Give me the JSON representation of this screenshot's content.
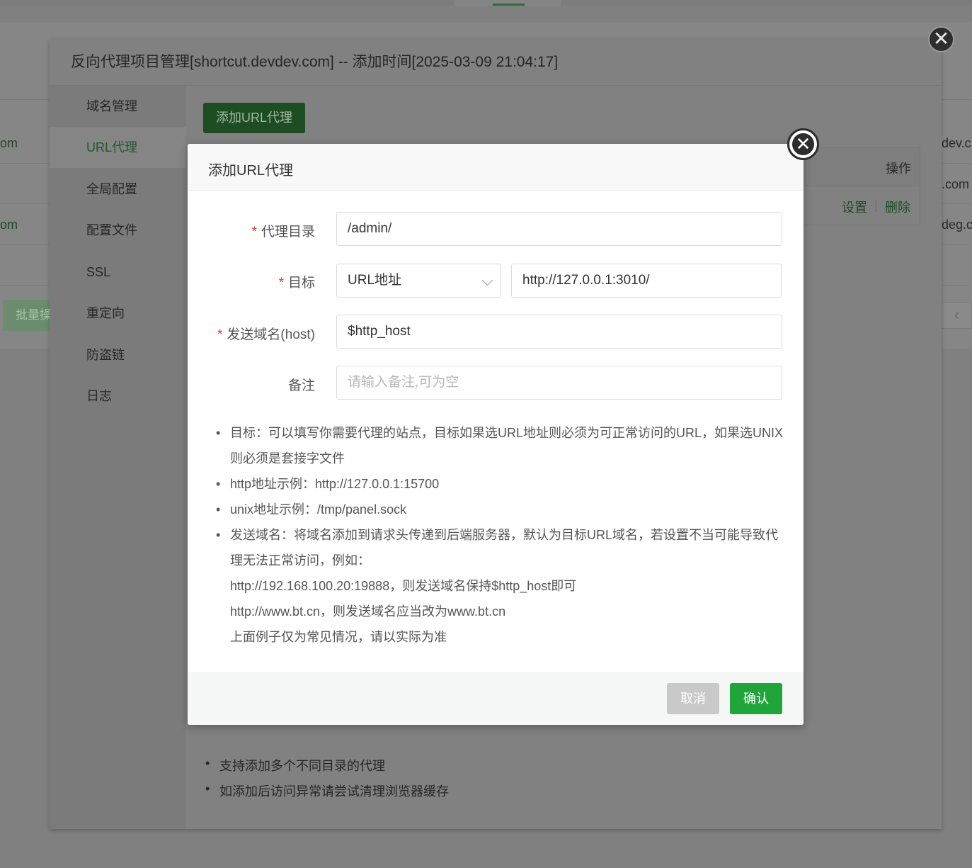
{
  "background": {
    "rows": [
      {
        "left_text": "om",
        "right_text": "dev.c"
      },
      {
        "left_text": "",
        "right_text": ".com"
      },
      {
        "left_text": "om",
        "right_text": "deg.c"
      }
    ],
    "batch_button_label": "批量操",
    "pager_prev": "‹"
  },
  "outer": {
    "title": "反向代理项目管理[shortcut.devdev.com] -- 添加时间[2025-03-09 21:04:17]",
    "close_glyph": "✕",
    "sidebar": [
      {
        "label": "域名管理"
      },
      {
        "label": "URL代理"
      },
      {
        "label": "全局配置"
      },
      {
        "label": "配置文件"
      },
      {
        "label": "SSL"
      },
      {
        "label": "重定向"
      },
      {
        "label": "防盗链"
      },
      {
        "label": "日志"
      }
    ],
    "add_button_label": "添加URL代理",
    "table_header_operation": "操作",
    "row_settings": "设置",
    "row_separator": "|",
    "row_delete": "删除",
    "tips": [
      "支持添加多个不同目录的代理",
      "如添加后访问异常请尝试清理浏览器缓存"
    ]
  },
  "dialog": {
    "title": "添加URL代理",
    "close_glyph": "✕",
    "required_mark": "*",
    "fields": {
      "proxy_dir": {
        "label": "代理目录",
        "value": "/admin/"
      },
      "target": {
        "label": "目标",
        "type_value": "URL地址",
        "url_value": "http://127.0.0.1:3010/"
      },
      "host": {
        "label": "发送域名(host)",
        "value": "$http_host"
      },
      "remark": {
        "label": "备注",
        "placeholder": "请输入备注,可为空"
      }
    },
    "help": {
      "item1_line1": "目标：可以填写你需要代理的站点，目标如果选URL地址则必须为可正常访问的URL，如果选UNIX",
      "item1_line2": "则必须是套接字文件",
      "item2": "http地址示例：http://127.0.0.1:15700",
      "item3": "unix地址示例：/tmp/panel.sock",
      "item4_line1": "发送域名：将域名添加到请求头传递到后端服务器，默认为目标URL域名，若设置不当可能导致代",
      "item4_line2": "理无法正常访问，例如：",
      "item4_line3": "http://192.168.100.20:19888，则发送域名保持$http_host即可",
      "item4_line4": "http://www.bt.cn，则发送域名应当改为www.bt.cn",
      "item4_line5": "上面例子仅为常见情况，请以实际为准"
    },
    "cancel_label": "取消",
    "confirm_label": "确认"
  },
  "colors": {
    "accent_green": "#20a53a",
    "required_red": "#e53935",
    "overlay": "#808080"
  }
}
